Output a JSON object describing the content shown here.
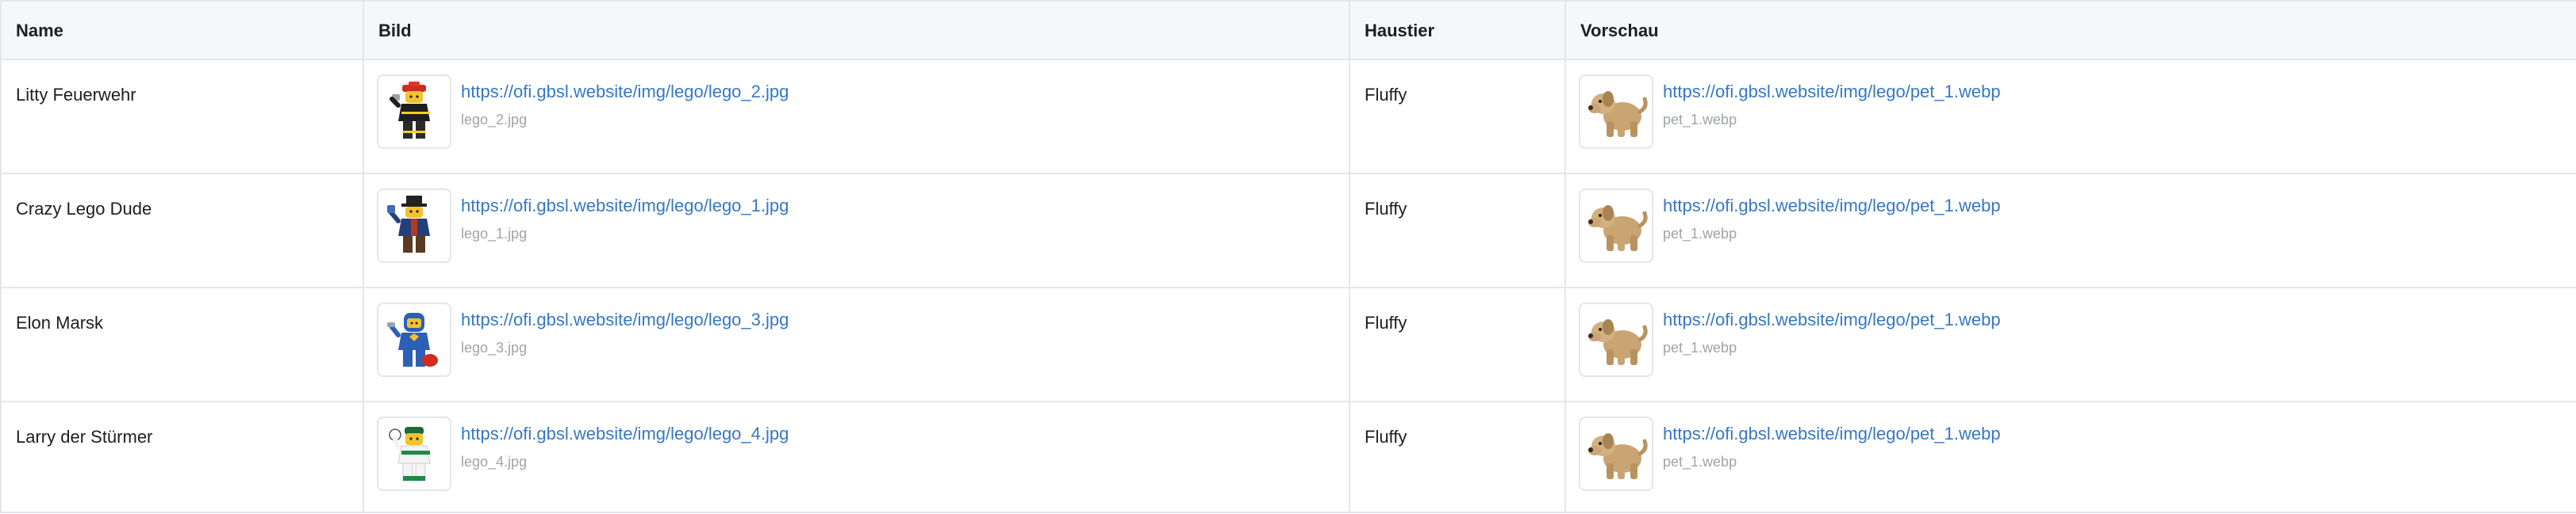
{
  "table": {
    "headers": {
      "name": "Name",
      "bild": "Bild",
      "haustier": "Haustier",
      "vorschau": "Vorschau"
    },
    "rows": [
      {
        "name": "Litty Feuerwehr",
        "bild_url": "https://ofi.gbsl.website/img/lego/lego_2.jpg",
        "bild_file": "lego_2.jpg",
        "bild_icon": "lego-firefighter-minifigure-icon",
        "haustier": "Fluffy",
        "vorschau_url": "https://ofi.gbsl.website/img/lego/pet_1.webp",
        "vorschau_file": "pet_1.webp",
        "vorschau_icon": "lego-dog-icon"
      },
      {
        "name": "Crazy Lego Dude",
        "bild_url": "https://ofi.gbsl.website/img/lego/lego_1.jpg",
        "bild_file": "lego_1.jpg",
        "bild_icon": "lego-top-hat-minifigure-icon",
        "haustier": "Fluffy",
        "vorschau_url": "https://ofi.gbsl.website/img/lego/pet_1.webp",
        "vorschau_file": "pet_1.webp",
        "vorschau_icon": "lego-dog-icon"
      },
      {
        "name": "Elon Marsk",
        "bild_url": "https://ofi.gbsl.website/img/lego/lego_3.jpg",
        "bild_file": "lego_3.jpg",
        "bild_icon": "lego-spaceman-minifigure-icon",
        "haustier": "Fluffy",
        "vorschau_url": "https://ofi.gbsl.website/img/lego/pet_1.webp",
        "vorschau_file": "pet_1.webp",
        "vorschau_icon": "lego-dog-icon"
      },
      {
        "name": "Larry der Stürmer",
        "bild_url": "https://ofi.gbsl.website/img/lego/lego_4.jpg",
        "bild_file": "lego_4.jpg",
        "bild_icon": "lego-footballer-minifigure-icon",
        "haustier": "Fluffy",
        "vorschau_url": "https://ofi.gbsl.website/img/lego/pet_1.webp",
        "vorschau_file": "pet_1.webp",
        "vorschau_icon": "lego-dog-icon"
      }
    ]
  },
  "colors": {
    "link": "#3578c5",
    "muted": "#a0a3a8",
    "border": "#e4e6eb",
    "header_bg": "#f6f7f9"
  }
}
